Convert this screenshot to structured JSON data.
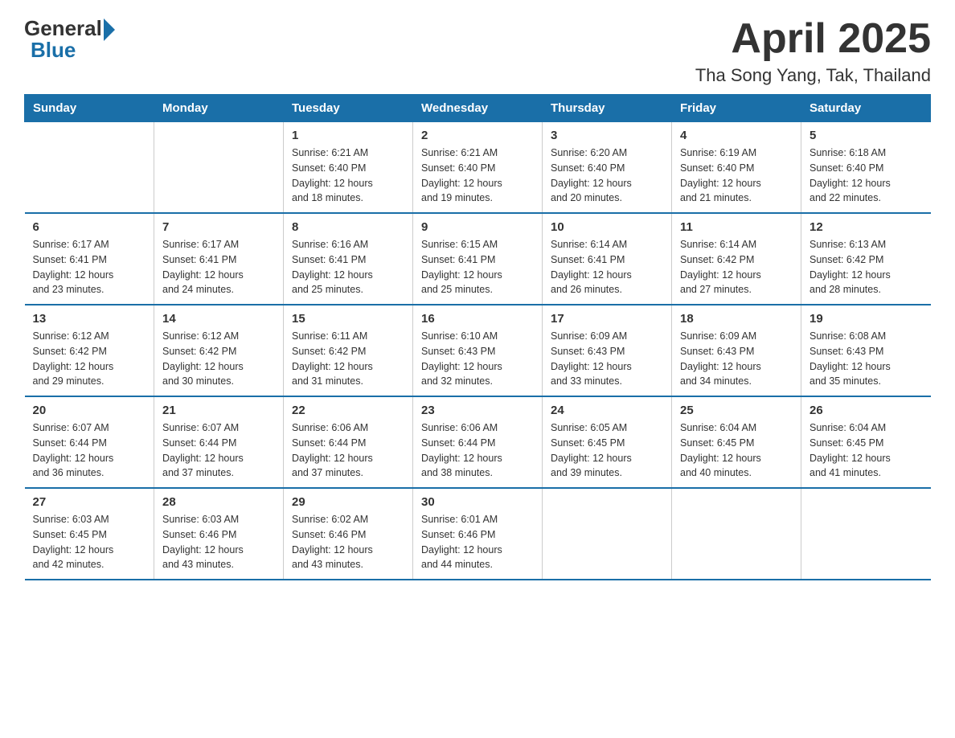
{
  "logo": {
    "general": "General",
    "blue": "Blue"
  },
  "title": "April 2025",
  "subtitle": "Tha Song Yang, Tak, Thailand",
  "days_of_week": [
    "Sunday",
    "Monday",
    "Tuesday",
    "Wednesday",
    "Thursday",
    "Friday",
    "Saturday"
  ],
  "weeks": [
    [
      {
        "day": "",
        "info": ""
      },
      {
        "day": "",
        "info": ""
      },
      {
        "day": "1",
        "info": "Sunrise: 6:21 AM\nSunset: 6:40 PM\nDaylight: 12 hours\nand 18 minutes."
      },
      {
        "day": "2",
        "info": "Sunrise: 6:21 AM\nSunset: 6:40 PM\nDaylight: 12 hours\nand 19 minutes."
      },
      {
        "day": "3",
        "info": "Sunrise: 6:20 AM\nSunset: 6:40 PM\nDaylight: 12 hours\nand 20 minutes."
      },
      {
        "day": "4",
        "info": "Sunrise: 6:19 AM\nSunset: 6:40 PM\nDaylight: 12 hours\nand 21 minutes."
      },
      {
        "day": "5",
        "info": "Sunrise: 6:18 AM\nSunset: 6:40 PM\nDaylight: 12 hours\nand 22 minutes."
      }
    ],
    [
      {
        "day": "6",
        "info": "Sunrise: 6:17 AM\nSunset: 6:41 PM\nDaylight: 12 hours\nand 23 minutes."
      },
      {
        "day": "7",
        "info": "Sunrise: 6:17 AM\nSunset: 6:41 PM\nDaylight: 12 hours\nand 24 minutes."
      },
      {
        "day": "8",
        "info": "Sunrise: 6:16 AM\nSunset: 6:41 PM\nDaylight: 12 hours\nand 25 minutes."
      },
      {
        "day": "9",
        "info": "Sunrise: 6:15 AM\nSunset: 6:41 PM\nDaylight: 12 hours\nand 25 minutes."
      },
      {
        "day": "10",
        "info": "Sunrise: 6:14 AM\nSunset: 6:41 PM\nDaylight: 12 hours\nand 26 minutes."
      },
      {
        "day": "11",
        "info": "Sunrise: 6:14 AM\nSunset: 6:42 PM\nDaylight: 12 hours\nand 27 minutes."
      },
      {
        "day": "12",
        "info": "Sunrise: 6:13 AM\nSunset: 6:42 PM\nDaylight: 12 hours\nand 28 minutes."
      }
    ],
    [
      {
        "day": "13",
        "info": "Sunrise: 6:12 AM\nSunset: 6:42 PM\nDaylight: 12 hours\nand 29 minutes."
      },
      {
        "day": "14",
        "info": "Sunrise: 6:12 AM\nSunset: 6:42 PM\nDaylight: 12 hours\nand 30 minutes."
      },
      {
        "day": "15",
        "info": "Sunrise: 6:11 AM\nSunset: 6:42 PM\nDaylight: 12 hours\nand 31 minutes."
      },
      {
        "day": "16",
        "info": "Sunrise: 6:10 AM\nSunset: 6:43 PM\nDaylight: 12 hours\nand 32 minutes."
      },
      {
        "day": "17",
        "info": "Sunrise: 6:09 AM\nSunset: 6:43 PM\nDaylight: 12 hours\nand 33 minutes."
      },
      {
        "day": "18",
        "info": "Sunrise: 6:09 AM\nSunset: 6:43 PM\nDaylight: 12 hours\nand 34 minutes."
      },
      {
        "day": "19",
        "info": "Sunrise: 6:08 AM\nSunset: 6:43 PM\nDaylight: 12 hours\nand 35 minutes."
      }
    ],
    [
      {
        "day": "20",
        "info": "Sunrise: 6:07 AM\nSunset: 6:44 PM\nDaylight: 12 hours\nand 36 minutes."
      },
      {
        "day": "21",
        "info": "Sunrise: 6:07 AM\nSunset: 6:44 PM\nDaylight: 12 hours\nand 37 minutes."
      },
      {
        "day": "22",
        "info": "Sunrise: 6:06 AM\nSunset: 6:44 PM\nDaylight: 12 hours\nand 37 minutes."
      },
      {
        "day": "23",
        "info": "Sunrise: 6:06 AM\nSunset: 6:44 PM\nDaylight: 12 hours\nand 38 minutes."
      },
      {
        "day": "24",
        "info": "Sunrise: 6:05 AM\nSunset: 6:45 PM\nDaylight: 12 hours\nand 39 minutes."
      },
      {
        "day": "25",
        "info": "Sunrise: 6:04 AM\nSunset: 6:45 PM\nDaylight: 12 hours\nand 40 minutes."
      },
      {
        "day": "26",
        "info": "Sunrise: 6:04 AM\nSunset: 6:45 PM\nDaylight: 12 hours\nand 41 minutes."
      }
    ],
    [
      {
        "day": "27",
        "info": "Sunrise: 6:03 AM\nSunset: 6:45 PM\nDaylight: 12 hours\nand 42 minutes."
      },
      {
        "day": "28",
        "info": "Sunrise: 6:03 AM\nSunset: 6:46 PM\nDaylight: 12 hours\nand 43 minutes."
      },
      {
        "day": "29",
        "info": "Sunrise: 6:02 AM\nSunset: 6:46 PM\nDaylight: 12 hours\nand 43 minutes."
      },
      {
        "day": "30",
        "info": "Sunrise: 6:01 AM\nSunset: 6:46 PM\nDaylight: 12 hours\nand 44 minutes."
      },
      {
        "day": "",
        "info": ""
      },
      {
        "day": "",
        "info": ""
      },
      {
        "day": "",
        "info": ""
      }
    ]
  ]
}
